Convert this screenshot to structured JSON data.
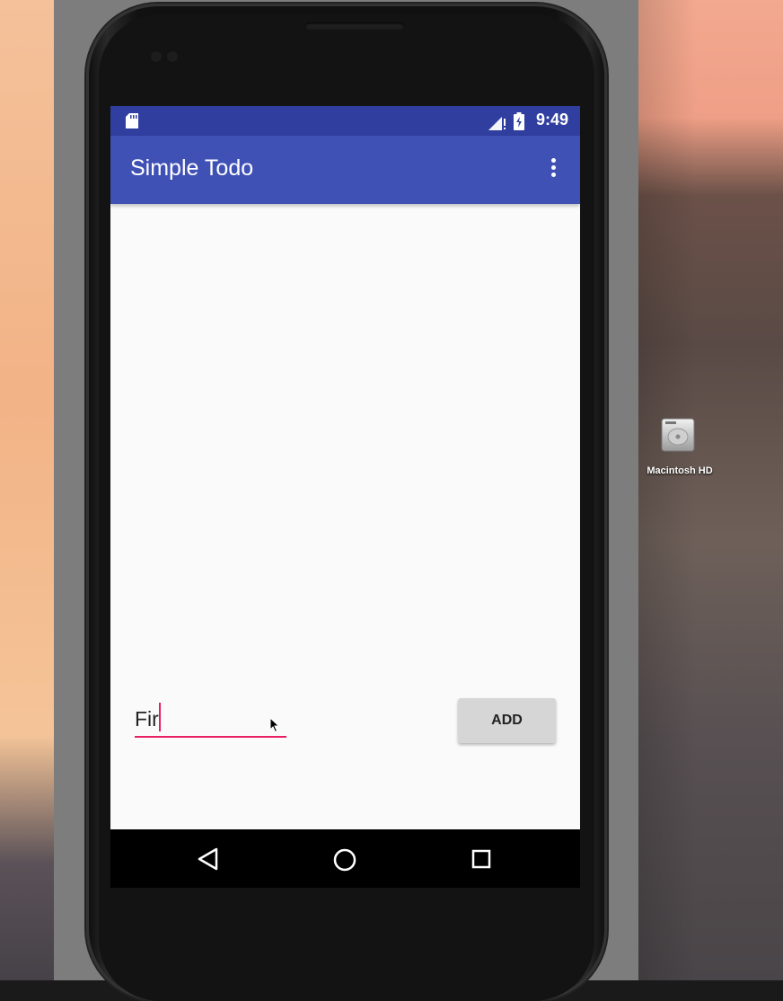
{
  "status_bar": {
    "time": "9:49",
    "icons": [
      "sd-card-icon",
      "signal-icon",
      "battery-icon"
    ]
  },
  "app_bar": {
    "title": "Simple Todo",
    "overflow_icon": "more-vert-icon"
  },
  "todo_list": {
    "items": []
  },
  "new_item": {
    "value": "Fir",
    "underline_color": "#e91e63"
  },
  "add_button": {
    "label": "ADD"
  },
  "navigation": {
    "icons": [
      "back-icon",
      "home-icon",
      "recents-icon"
    ]
  },
  "desktop": {
    "drive_label": "Macintosh HD"
  },
  "colors": {
    "primary": "#3f51b5",
    "primary_dark": "#303f9f",
    "accent": "#e91e63"
  }
}
